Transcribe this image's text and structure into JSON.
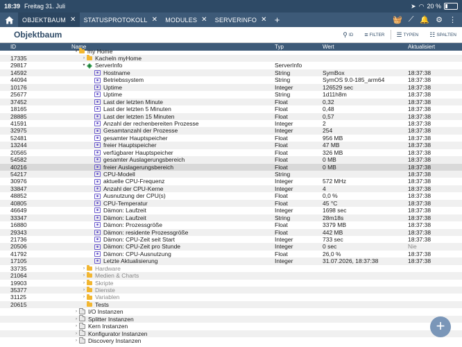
{
  "status_bar": {
    "time": "18:39",
    "date": "Freitag 31. Juli",
    "battery": "20 %",
    "battery_level": 0.2
  },
  "tabs": [
    {
      "label": "OBJEKTBAUM",
      "active": true
    },
    {
      "label": "STATUSPROTOKOLL"
    },
    {
      "label": "MODULES"
    },
    {
      "label": "SERVERINFO"
    }
  ],
  "header": {
    "title": "Objektbaum",
    "btn_id": "ID",
    "btn_filter": "FILTER",
    "btn_types": "TYPEN",
    "btn_columns": "SPALTEN"
  },
  "columns": {
    "id": "ID",
    "name": "Name",
    "type": "Typ",
    "value": "Wert",
    "updated": "Aktualisiert"
  },
  "rows": [
    {
      "id": "",
      "name": "my Home",
      "indent": 1,
      "icon": "folder",
      "caret": "▾",
      "partial": true
    },
    {
      "id": "17335",
      "name": "Kacheln myHome",
      "indent": 2,
      "icon": "folder",
      "caret": "›"
    },
    {
      "id": "29817",
      "name": "ServerInfo",
      "indent": 2,
      "icon": "instance",
      "caret": "▾",
      "type": "ServerInfo"
    },
    {
      "id": "14592",
      "name": "Hostname",
      "indent": 3,
      "icon": "var",
      "type": "String",
      "value": "SymBox",
      "updated": "18:37:38"
    },
    {
      "id": "44094",
      "name": "Betriebssystem",
      "indent": 3,
      "icon": "var",
      "type": "String",
      "value": "SymOS 9.0-185_arm64",
      "updated": "18:37:38"
    },
    {
      "id": "10176",
      "name": "Uptime",
      "indent": 3,
      "icon": "var",
      "type": "Integer",
      "value": "126529 sec",
      "updated": "18:37:38"
    },
    {
      "id": "25677",
      "name": "Uptime",
      "indent": 3,
      "icon": "var",
      "type": "String",
      "value": "1d11h8m",
      "updated": "18:37:38"
    },
    {
      "id": "37452",
      "name": "Last der letzten Minute",
      "indent": 3,
      "icon": "var",
      "type": "Float",
      "value": "0,32",
      "updated": "18:37:38"
    },
    {
      "id": "18165",
      "name": "Last der letzten 5 Minuten",
      "indent": 3,
      "icon": "var",
      "type": "Float",
      "value": "0,48",
      "updated": "18:37:38"
    },
    {
      "id": "28885",
      "name": "Last der letzten 15 Minuten",
      "indent": 3,
      "icon": "var",
      "type": "Float",
      "value": "0,57",
      "updated": "18:37:38"
    },
    {
      "id": "41591",
      "name": "Anzahl der rechenbereiten Prozesse",
      "indent": 3,
      "icon": "var",
      "type": "Integer",
      "value": "2",
      "updated": "18:37:38"
    },
    {
      "id": "32975",
      "name": "Gesamtanzahl der Prozesse",
      "indent": 3,
      "icon": "var",
      "type": "Integer",
      "value": "254",
      "updated": "18:37:38"
    },
    {
      "id": "52481",
      "name": "gesamter Hauptspeicher",
      "indent": 3,
      "icon": "var",
      "type": "Float",
      "value": "956 MB",
      "updated": "18:37:38"
    },
    {
      "id": "13244",
      "name": "freier Hauptspeicher",
      "indent": 3,
      "icon": "var",
      "type": "Float",
      "value": "47 MB",
      "updated": "18:37:38"
    },
    {
      "id": "20565",
      "name": "verfügbarer Hauptspeicher",
      "indent": 3,
      "icon": "var",
      "type": "Float",
      "value": "326 MB",
      "updated": "18:37:38"
    },
    {
      "id": "54582",
      "name": "gesamter Auslagerungsbereich",
      "indent": 3,
      "icon": "var",
      "type": "Float",
      "value": "0 MB",
      "updated": "18:37:38"
    },
    {
      "id": "40216",
      "name": "freier Auslagerungsbereich",
      "indent": 3,
      "icon": "var",
      "type": "Float",
      "value": "0 MB",
      "updated": "18:37:38",
      "selected": true
    },
    {
      "id": "54217",
      "name": "CPU-Modell",
      "indent": 3,
      "icon": "var",
      "type": "String",
      "value": "",
      "updated": "18:37:38"
    },
    {
      "id": "30976",
      "name": "aktuelle CPU-Frequenz",
      "indent": 3,
      "icon": "var",
      "type": "Integer",
      "value": "572 MHz",
      "updated": "18:37:38"
    },
    {
      "id": "33847",
      "name": "Anzahl der CPU-Kerne",
      "indent": 3,
      "icon": "var",
      "type": "Integer",
      "value": "4",
      "updated": "18:37:38"
    },
    {
      "id": "48852",
      "name": "Ausnutzung der CPU(s)",
      "indent": 3,
      "icon": "var",
      "type": "Float",
      "value": "0,0 %",
      "updated": "18:37:38"
    },
    {
      "id": "40805",
      "name": "CPU-Temperatur",
      "indent": 3,
      "icon": "var",
      "type": "Float",
      "value": "45 °C",
      "updated": "18:37:38"
    },
    {
      "id": "46649",
      "name": "Dämon: Laufzeit",
      "indent": 3,
      "icon": "var",
      "type": "Integer",
      "value": "1698 sec",
      "updated": "18:37:38"
    },
    {
      "id": "33347",
      "name": "Dämon: Laufzeit",
      "indent": 3,
      "icon": "var",
      "type": "String",
      "value": "28m18s",
      "updated": "18:37:38"
    },
    {
      "id": "16880",
      "name": "Dämon: Prozessgröße",
      "indent": 3,
      "icon": "var",
      "type": "Float",
      "value": "3379 MB",
      "updated": "18:37:38"
    },
    {
      "id": "29343",
      "name": "Dämon: residente Prozessgröße",
      "indent": 3,
      "icon": "var",
      "type": "Float",
      "value": "442 MB",
      "updated": "18:37:38"
    },
    {
      "id": "21736",
      "name": "Dämon: CPU-Zeit seit Start",
      "indent": 3,
      "icon": "var",
      "type": "Integer",
      "value": "733 sec",
      "updated": "18:37:38"
    },
    {
      "id": "20506",
      "name": "Dämon: CPU-Zeit pro Stunde",
      "indent": 3,
      "icon": "var",
      "type": "Integer",
      "value": "0 sec",
      "updated": "Nie",
      "muted_time": true
    },
    {
      "id": "41792",
      "name": "Dämon: CPU-Ausnutzung",
      "indent": 3,
      "icon": "var",
      "type": "Float",
      "value": "26,0 %",
      "updated": "18:37:38"
    },
    {
      "id": "17105",
      "name": "Letzte Aktualisierung",
      "indent": 3,
      "icon": "var",
      "type": "Integer",
      "value": "31.07.2026, 18:37:38",
      "updated": "18:37:38"
    },
    {
      "id": "33735",
      "name": "Hardware",
      "indent": 2,
      "icon": "folder",
      "caret": "›",
      "muted": true
    },
    {
      "id": "21064",
      "name": "Medien & Charts",
      "indent": 2,
      "icon": "folder",
      "caret": "›",
      "muted": true
    },
    {
      "id": "19903",
      "name": "Skripte",
      "indent": 2,
      "icon": "folder",
      "caret": "›",
      "muted": true
    },
    {
      "id": "35377",
      "name": "Dienste",
      "indent": 2,
      "icon": "folder",
      "caret": "›",
      "muted": true
    },
    {
      "id": "31125",
      "name": "Variablen",
      "indent": 2,
      "icon": "folder",
      "caret": "›",
      "muted": true
    },
    {
      "id": "20615",
      "name": "Tests",
      "indent": 2,
      "icon": "folder",
      "caret": ""
    },
    {
      "id": "",
      "name": "I/O Instanzen",
      "indent": 1,
      "icon": "folder-grey",
      "caret": "›"
    },
    {
      "id": "",
      "name": "Splitter Instanzen",
      "indent": 1,
      "icon": "folder-grey",
      "caret": "›"
    },
    {
      "id": "",
      "name": "Kern Instanzen",
      "indent": 1,
      "icon": "folder-grey",
      "caret": "›"
    },
    {
      "id": "",
      "name": "Konfigurator Instanzen",
      "indent": 1,
      "icon": "folder-grey",
      "caret": "›"
    },
    {
      "id": "",
      "name": "Discovery Instanzen",
      "indent": 1,
      "icon": "folder-grey",
      "caret": "›"
    }
  ],
  "fab": {
    "label": "+"
  }
}
